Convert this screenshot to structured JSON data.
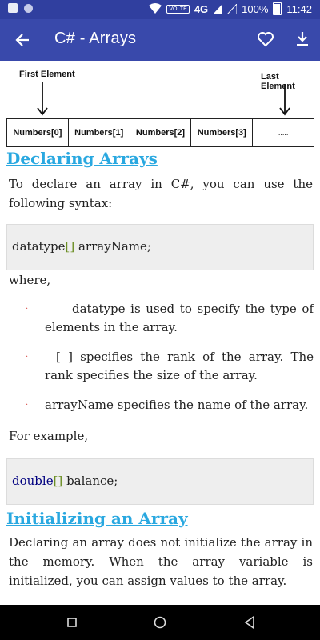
{
  "status_bar": {
    "network": "4G",
    "volte": "VOLTE",
    "battery": "100%",
    "time": "11:42"
  },
  "app_bar": {
    "title": "C# - Arrays",
    "back_icon": "arrow-back-icon",
    "favorite_icon": "heart-outline-icon",
    "download_icon": "download-icon"
  },
  "diagram": {
    "first_label": "First Element",
    "last_label": "Last Element",
    "cells": [
      "Numbers[0]",
      "Numbers[1]",
      "Numbers[2]",
      "Numbers[3]",
      "....."
    ]
  },
  "section1": {
    "heading": "Declaring Arrays",
    "intro": "To declare an array in C#, you can use the following syntax:",
    "code": {
      "type": "datatype",
      "brackets": "[]",
      "rest": " arrayName;"
    },
    "where": "where,",
    "bullets": [
      "datatype is used to specify the type of elements in the array.",
      "[ ] specifies the rank of the array. The rank specifies the size of the array.",
      "arrayName specifies the name of the array."
    ],
    "example_intro": "For example,",
    "example_code": {
      "type": "double",
      "brackets": "[]",
      "rest": " balance;"
    }
  },
  "section2": {
    "heading": "Initializing an Array",
    "text": "Declaring an array does not initialize the array in the memory. When the array variable is initialized, you can assign values to the array."
  },
  "nav_bar": {
    "recents_icon": "square-recents-icon",
    "home_icon": "circle-home-icon",
    "back_icon": "triangle-back-icon"
  },
  "colors": {
    "status_bar": "#303f9f",
    "app_bar": "#3949ab",
    "heading": "#29a8e0",
    "code_bg": "#eeeeee"
  }
}
